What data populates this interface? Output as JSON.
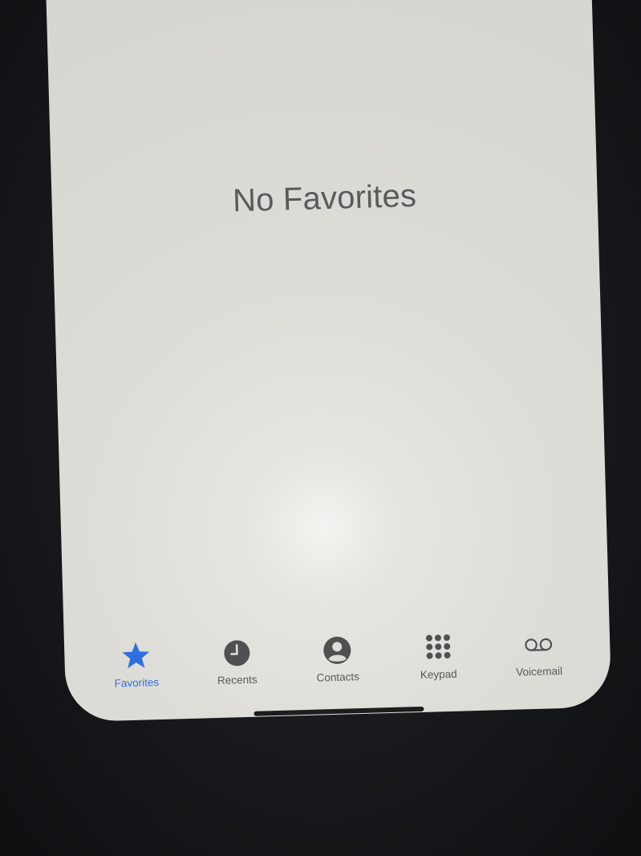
{
  "empty_state": {
    "title": "No Favorites"
  },
  "tabbar": {
    "active": "favorites",
    "tabs": [
      {
        "id": "favorites",
        "label": "Favorites",
        "icon": "star-icon"
      },
      {
        "id": "recents",
        "label": "Recents",
        "icon": "clock-icon"
      },
      {
        "id": "contacts",
        "label": "Contacts",
        "icon": "person-icon"
      },
      {
        "id": "keypad",
        "label": "Keypad",
        "icon": "keypad-icon"
      },
      {
        "id": "voicemail",
        "label": "Voicemail",
        "icon": "voicemail-icon"
      }
    ]
  },
  "colors": {
    "accent": "#2f6fe0",
    "icon_inactive": "#505052",
    "screen_bg": "#dddcd7"
  }
}
